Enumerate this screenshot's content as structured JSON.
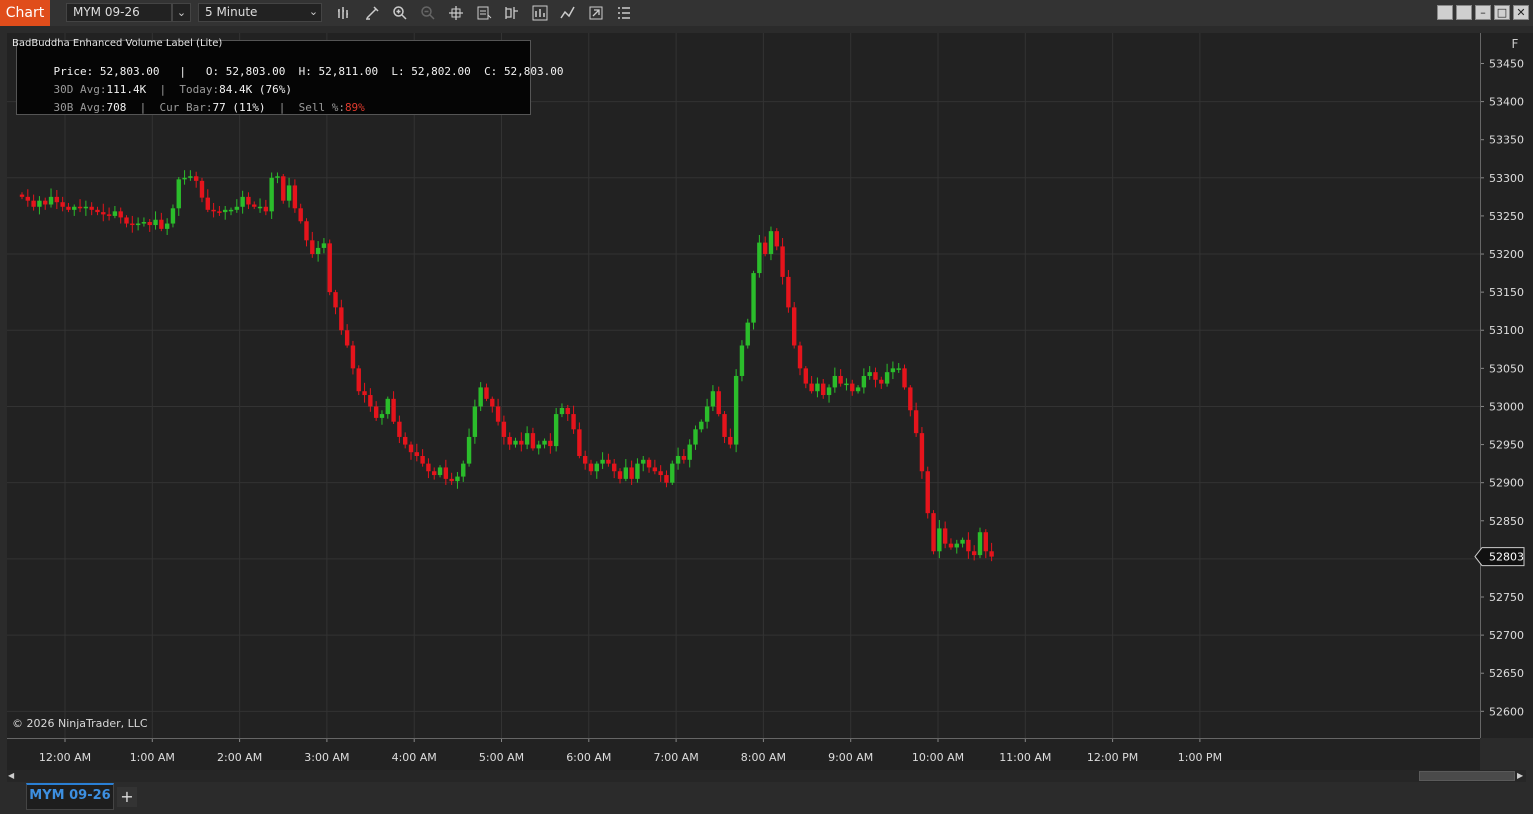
{
  "toolbar": {
    "chart_label": "Chart",
    "instrument": "MYM 09-26",
    "interval": "5 Minute"
  },
  "indicator": {
    "title": "BadBuddha Enhanced Volume Label (Lite)",
    "price_label": "Price:",
    "price": "52,803.00",
    "open_label": "O:",
    "open": "52,803.00",
    "high_label": "H:",
    "high": "52,811.00",
    "low_label": "L:",
    "low": "52,802.00",
    "close_label": "C:",
    "close": "52,803.00",
    "avg30d_label": "30D Avg:",
    "avg30d": "111.4K",
    "today_label": "Today:",
    "today": "84.4K (76%)",
    "avg30b_label": "30B Avg:",
    "avg30b": "708",
    "curbar_label": "Cur Bar:",
    "curbar": "77 (11%)",
    "sell_label": "Sell %:",
    "sell": "89%",
    "sep": "|"
  },
  "copyright": "© 2026 NinjaTrader, LLC",
  "f_button": "F",
  "tab_label": "MYM 09-26",
  "add_tab": "+",
  "current_price_label": "52803",
  "colors": {
    "up": "#2bbd2b",
    "down": "#e5141c",
    "accent": "#e04d1b",
    "tab": "#3d8fe0"
  },
  "chart_data": {
    "type": "candlestick",
    "price_ticks": [
      53450,
      53400,
      53350,
      53300,
      53250,
      53200,
      53150,
      53100,
      53050,
      53000,
      52950,
      52900,
      52850,
      52800,
      52750,
      52700,
      52650,
      52600
    ],
    "time_ticks": [
      "12:00 AM",
      "1:00 AM",
      "2:00 AM",
      "3:00 AM",
      "4:00 AM",
      "5:00 AM",
      "6:00 AM",
      "7:00 AM",
      "8:00 AM",
      "9:00 AM",
      "10:00 AM",
      "11:00 AM",
      "12:00 PM",
      "1:00 PM"
    ],
    "ylim": [
      52565,
      53490
    ],
    "grid": true,
    "last_price": 52803,
    "closes": [
      53275,
      53270,
      53262,
      53270,
      53265,
      53275,
      53268,
      53262,
      53258,
      53262,
      53260,
      53262,
      53258,
      53255,
      53252,
      53250,
      53256,
      53248,
      53240,
      53238,
      53240,
      53242,
      53238,
      53245,
      53233,
      53240,
      53260,
      53298,
      53300,
      53302,
      53296,
      53274,
      53258,
      53256,
      53255,
      53258,
      53258,
      53262,
      53275,
      53265,
      53262,
      53262,
      53256,
      53300,
      53302,
      53270,
      53290,
      53260,
      53243,
      53218,
      53200,
      53208,
      53214,
      53150,
      53130,
      53100,
      53080,
      53050,
      53020,
      53015,
      53000,
      52985,
      52990,
      53010,
      52980,
      52960,
      52950,
      52940,
      52935,
      52925,
      52915,
      52910,
      52920,
      52905,
      52902,
      52908,
      52925,
      52960,
      53000,
      53025,
      53010,
      53000,
      52980,
      52960,
      52950,
      52955,
      52950,
      52965,
      52945,
      52950,
      52955,
      52948,
      52990,
      52998,
      52990,
      52970,
      52935,
      52925,
      52915,
      52925,
      52930,
      52925,
      52915,
      52905,
      52920,
      52905,
      52925,
      52930,
      52920,
      52915,
      52910,
      52900,
      52925,
      52935,
      52930,
      52950,
      52970,
      52980,
      53000,
      53020,
      52990,
      52960,
      52950,
      53040,
      53080,
      53110,
      53175,
      53215,
      53200,
      53230,
      53210,
      53170,
      53130,
      53080,
      53050,
      53030,
      53020,
      53030,
      53015,
      53025,
      53040,
      53030,
      53030,
      53020,
      53025,
      53040,
      53045,
      53035,
      53030,
      53045,
      53050,
      53050,
      53025,
      52995,
      52965,
      52915,
      52860,
      52810,
      52840,
      52820,
      52815,
      52820,
      52825,
      52810,
      52805,
      52835,
      52810,
      52803
    ]
  }
}
